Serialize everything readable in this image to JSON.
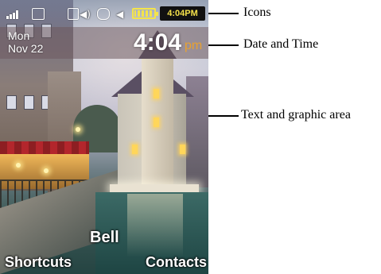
{
  "status_bar": {
    "time": "4:04PM"
  },
  "datetime": {
    "weekday": "Mon",
    "month_day": "Nov 22",
    "time": "4:04",
    "ampm": "pm"
  },
  "carrier": "Bell",
  "softkeys": {
    "left": "Shortcuts",
    "right": "Contacts"
  },
  "callouts": {
    "icons": "Icons",
    "date_time": "Date and Time",
    "text_graphic": "Text and graphic area"
  },
  "colors": {
    "ampm_accent": "#e8a130",
    "clock_text": "#f3e04a",
    "battery": "#f4e44a"
  }
}
